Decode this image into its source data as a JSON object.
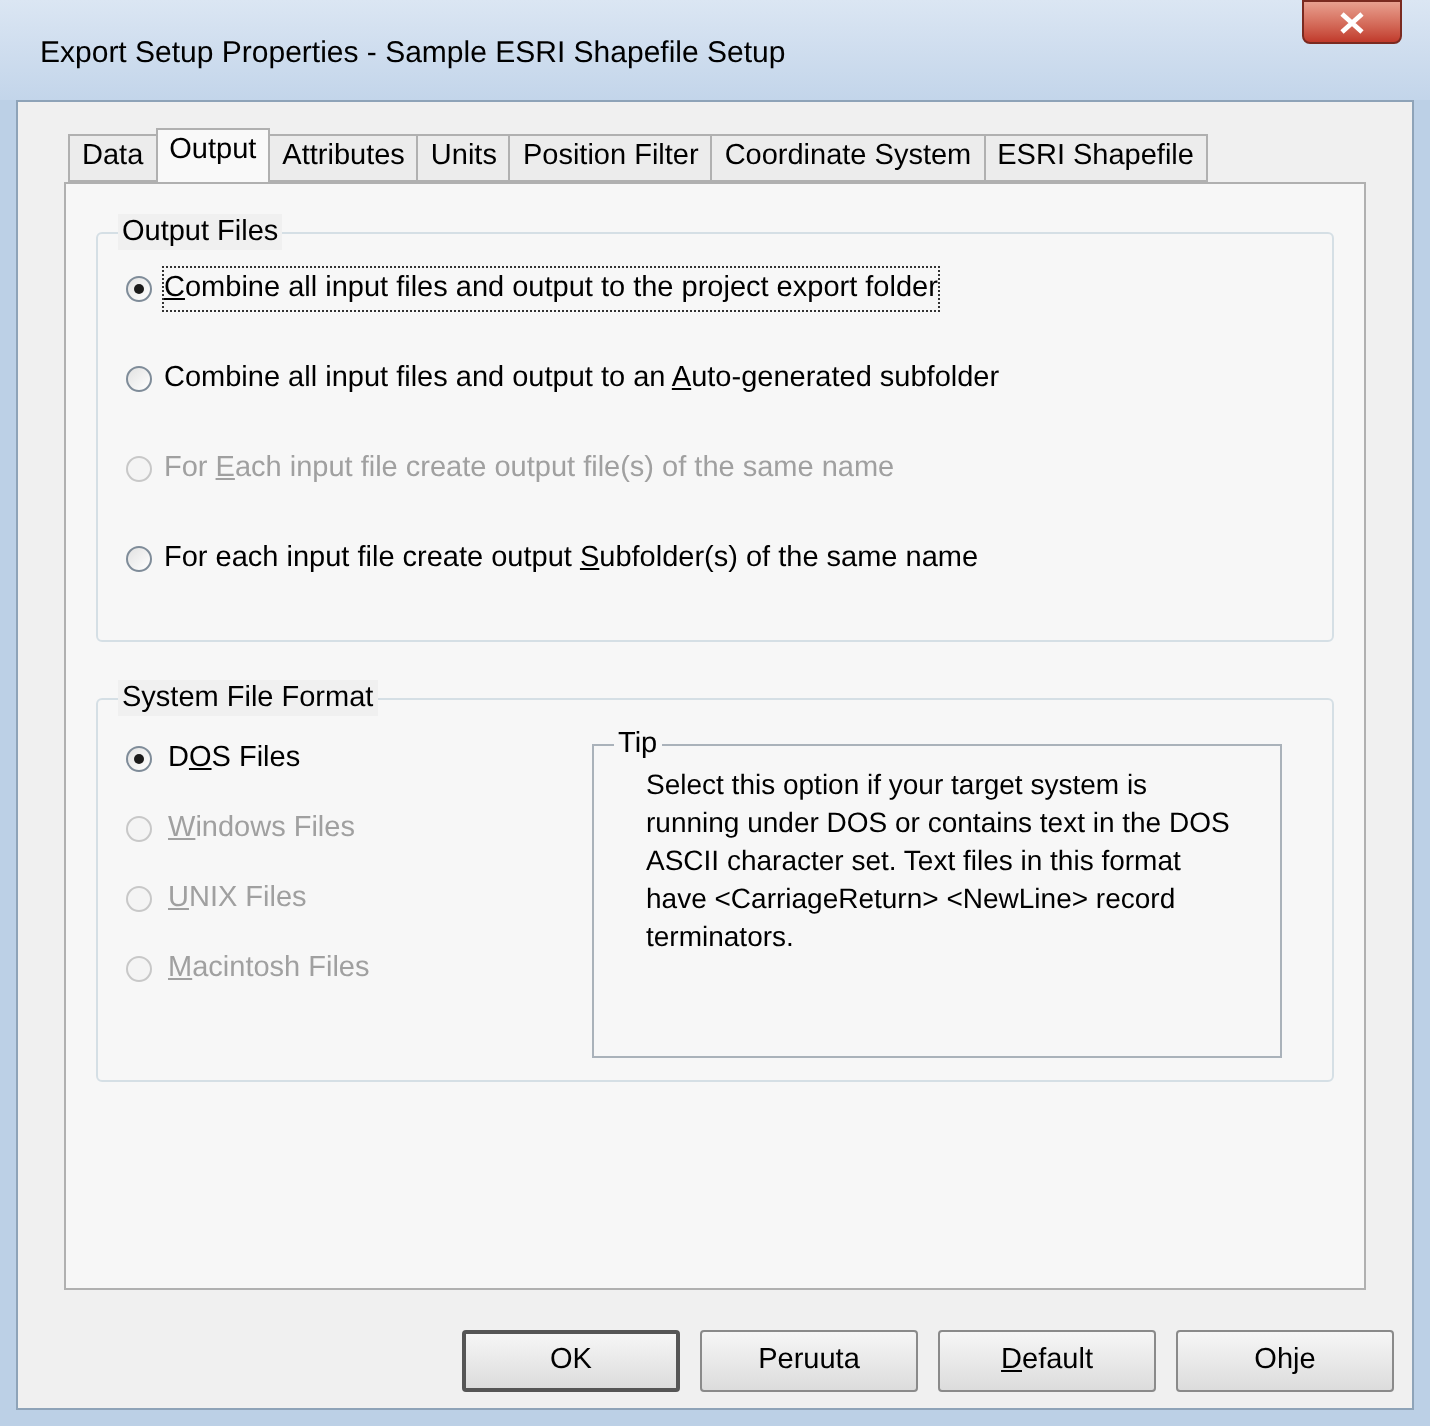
{
  "window": {
    "title": "Export Setup Properties - Sample ESRI Shapefile Setup"
  },
  "tabs": [
    {
      "label": "Data",
      "selected": false
    },
    {
      "label": "Output",
      "selected": true
    },
    {
      "label": "Attributes",
      "selected": false
    },
    {
      "label": "Units",
      "selected": false
    },
    {
      "label": "Position Filter",
      "selected": false
    },
    {
      "label": "Coordinate System",
      "selected": false
    },
    {
      "label": "ESRI Shapefile",
      "selected": false
    }
  ],
  "output_files": {
    "title": "Output Files",
    "options": [
      {
        "label": {
          "key": "C",
          "after": "ombine all input files and output to the project export folder"
        },
        "selected": true,
        "disabled": false,
        "focused": true
      },
      {
        "label": {
          "before": "Combine all input files and output to an ",
          "key": "A",
          "after": "uto-generated subfolder"
        },
        "selected": false,
        "disabled": false,
        "focused": false
      },
      {
        "label": {
          "before": "For ",
          "key": "E",
          "after": "ach input file create output file(s) of the same name"
        },
        "selected": false,
        "disabled": true,
        "focused": false
      },
      {
        "label": {
          "before": "For each input file create output ",
          "key": "S",
          "after": "ubfolder(s) of the same name"
        },
        "selected": false,
        "disabled": false,
        "focused": false
      }
    ]
  },
  "system_file_format": {
    "title": "System File Format",
    "options": [
      {
        "label": {
          "before": "D",
          "key": "O",
          "after": "S Files"
        },
        "selected": true,
        "disabled": false
      },
      {
        "label": {
          "key": "W",
          "after": "indows Files"
        },
        "selected": false,
        "disabled": true
      },
      {
        "label": {
          "key": "U",
          "after": "NIX Files"
        },
        "selected": false,
        "disabled": true
      },
      {
        "label": {
          "key": "M",
          "after": "acintosh Files"
        },
        "selected": false,
        "disabled": true
      }
    ],
    "tip": {
      "title": "Tip",
      "text": "Select this option if your target system is running under DOS or contains text in the DOS ASCII character set. Text files in this format have <CarriageReturn> <NewLine> record terminators."
    }
  },
  "buttons": [
    {
      "label": {
        "after": "OK"
      },
      "default": true
    },
    {
      "label": {
        "after": "Peruuta"
      },
      "default": false
    },
    {
      "label": {
        "key": "D",
        "after": "efault"
      },
      "default": false
    },
    {
      "label": {
        "after": "Ohje"
      },
      "default": false
    }
  ]
}
